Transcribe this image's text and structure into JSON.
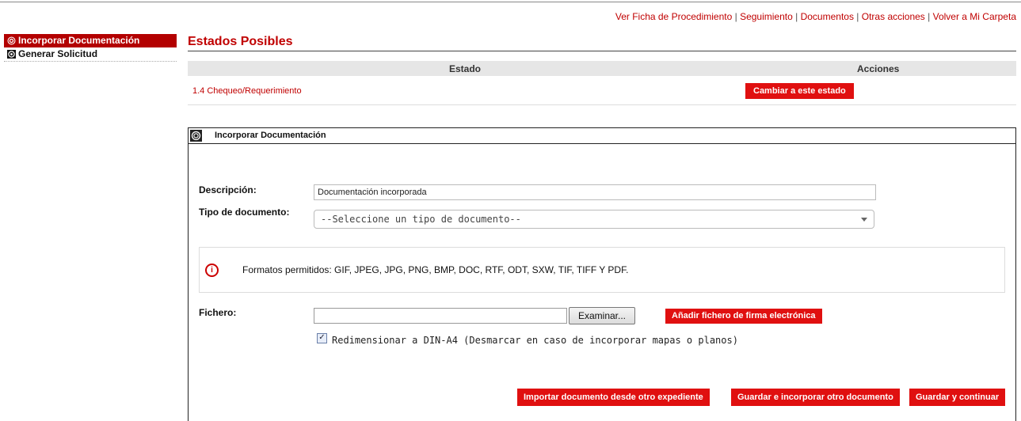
{
  "top_links": {
    "ficha": "Ver Ficha de Procedimiento",
    "seguimiento": "Seguimiento",
    "documentos": "Documentos",
    "otras": "Otras acciones",
    "volver": "Volver a Mi Carpeta",
    "separator": " | "
  },
  "sidebar": {
    "items": [
      {
        "label": "Incorporar Documentación",
        "icon": "circle-bullet-icon"
      },
      {
        "label": "Generar Solicitud",
        "icon": "circle-bullet-icon"
      }
    ]
  },
  "main": {
    "title": "Estados Posibles",
    "table": {
      "headers": [
        "Estado",
        "Acciones"
      ],
      "rows": [
        {
          "estado": "1.4 Chequeo/Requerimiento",
          "action": "Cambiar a este estado"
        }
      ]
    }
  },
  "panel": {
    "title": "Incorporar Documentación",
    "descripcion_label": "Descripción:",
    "descripcion_value": "Documentación incorporada",
    "tipo_label": "Tipo de documento:",
    "tipo_selected": "--Seleccione un tipo de documento--",
    "info_text": "Formatos permitidos: GIF, JPEG, JPG, PNG, BMP, DOC, RTF, ODT, SXW, TIF, TIFF Y PDF.",
    "fichero_label": "Fichero:",
    "browse_label": "Examinar...",
    "sign_button": "Añadir fichero de firma electrónica",
    "resize_label": "Redimensionar a DIN-A4 (Desmarcar en caso de incorporar mapas o planos)",
    "resize_checked": true,
    "buttons": {
      "importar": "Importar documento desde otro expediente",
      "guardar_otro": "Guardar e incorporar otro documento",
      "guardar_continuar": "Guardar y continuar"
    }
  },
  "colors": {
    "accent": "#c00000",
    "button": "#e01010",
    "sidebar_active": "#b30000"
  }
}
